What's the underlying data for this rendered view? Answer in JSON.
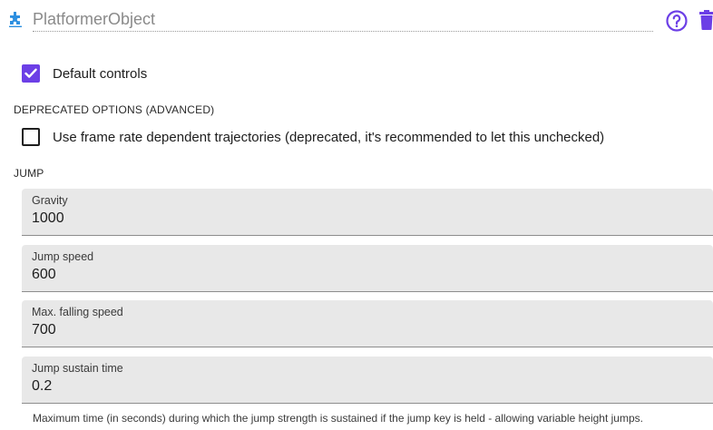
{
  "header": {
    "object_name": "PlatformerObject",
    "icons": [
      "puzzle-icon",
      "help-icon",
      "trash-icon"
    ]
  },
  "controls": {
    "default_controls": {
      "label": "Default controls",
      "checked": true
    }
  },
  "deprecated": {
    "title": "DEPRECATED OPTIONS (ADVANCED)",
    "frame_rate_option": {
      "label": "Use frame rate dependent trajectories (deprecated, it's recommended to let this unchecked)",
      "checked": false
    }
  },
  "jump": {
    "title": "JUMP",
    "fields": [
      {
        "label": "Gravity",
        "value": "1000"
      },
      {
        "label": "Jump speed",
        "value": "600"
      },
      {
        "label": "Max. falling speed",
        "value": "700"
      },
      {
        "label": "Jump sustain time",
        "value": "0.2"
      }
    ],
    "helper": "Maximum time (in seconds) during which the jump strength is sustained if the jump key is held - allowing variable height jumps."
  },
  "colors": {
    "accent": "#6c3fe6",
    "field_bg": "#e8e8e8",
    "header_puzzle": "#2d8fe0"
  }
}
